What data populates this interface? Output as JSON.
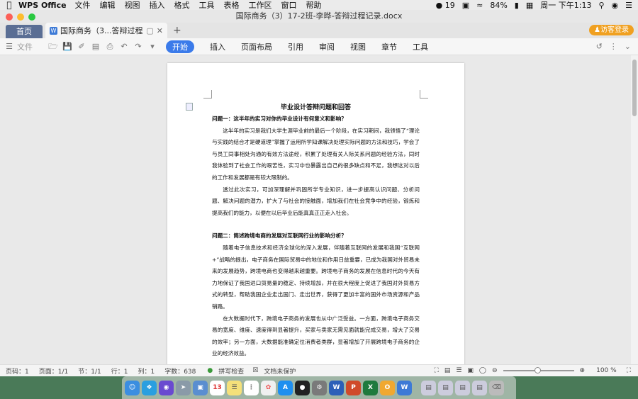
{
  "menubar": {
    "app_name": "WPS Office",
    "items": [
      "文件",
      "编辑",
      "视图",
      "插入",
      "格式",
      "工具",
      "表格",
      "工作区",
      "窗口",
      "帮助"
    ],
    "notifications": "19",
    "battery": "84%",
    "datetime": "周一 下午1:13"
  },
  "window": {
    "title": "国际商务（3）17-2班-李晔-答辩过程记录.docx"
  },
  "tabs": {
    "home_label": "首页",
    "doc_label": "国际商务（3...答辩过程记录",
    "login_label": "访客登录"
  },
  "toolbar": {
    "file_label": "文件",
    "ribbon_tabs": [
      "开始",
      "插入",
      "页面布局",
      "引用",
      "审阅",
      "视图",
      "章节",
      "工具"
    ]
  },
  "document": {
    "title": "毕业设计答辩问题和回答",
    "q1": "问题一：这半年的实习对你的毕业设计有何意义和影响？",
    "q1_p1": "这半年的实习是我们大学生涯毕业前的最后一个阶段，在实习期间，我领悟了“理论与实践的结合才是硬道理”掌握了运用所学知课解决处理实际问题的方法和技巧，学会了与员工同事相处沟通的有效方法途经，积累了处理有关人际关系问题的经验方法，同时我体验到了社会工作的艰苦性，实习中也暴露出自己的很多缺点和不足，我想这对以后的工作和发展都是有较大限制的。",
    "q1_p2": "透过此次实习，可加深理解并巩固所学专业知识，进一步提高认识问题、分析问题、解决问题的潜力，扩大了与社会的接触面，增加我们在社会竞争中的经验，锻炼和提高我们的能力，以便在以后毕业后能真真正正走入社会。",
    "q2": "问题二：简述跨境电商的发展对互联网行业的影响分析？",
    "q2_p1": "随着电子信息技术和经济全球化的深入发展，伴随着互联网的发展和我国“互联网+”战略的提出，电子商务在国际贸易中的地位和作用日益重要，已成为我国对外贸易未来的发展趋势，跨境电商也变得越来越重要。跨境电子商务的发展在信息时代的今天有力地保证了我国进口贸易量的稳定、持续增加，并在很大程度上促进了我国对外贸易方式的转型，帮助我国企业走出国门、走出世界，获得了更加丰富的国外市场资源和产品销路。",
    "q2_p2": "在大数据时代下，跨境电子商务的发展也从中广泛受益。一方面，跨境电子商务交易的宽度、维度、速度得到显著提升，买家与卖家无需见面就能完成交易，增大了交易的效率；另一方面，大数据能准确定位消费者类群，显著增加了开展跨境电子商务的企业的经济效益。"
  },
  "status": {
    "page_num": "页码：1",
    "page_count": "页面：1/1",
    "section": "节：1/1",
    "row": "行：1",
    "col": "列：1",
    "words": "字数：638",
    "spell": "拼写检查",
    "protect": "文档未保护",
    "zoom": "100 %"
  },
  "dock": {
    "apps": [
      "Finder",
      "Safari",
      "Siri",
      "Launchpad",
      "Preview",
      "Calendar",
      "Notes",
      "Reminders",
      "Photos",
      "App Store",
      "QQ",
      "System Preferences",
      "Word",
      "PowerPoint",
      "Excel",
      "Outlook",
      "WPS",
      "Trash"
    ],
    "calendar_day": "13"
  }
}
